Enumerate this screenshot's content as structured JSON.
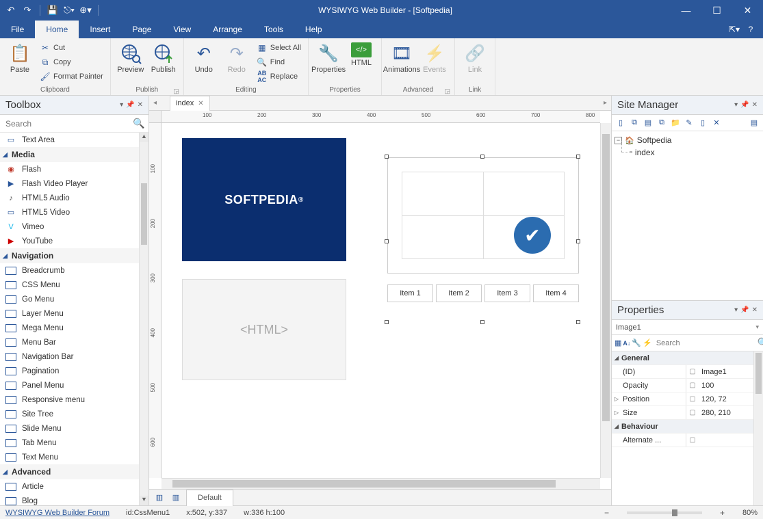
{
  "title": "WYSIWYG Web Builder - [Softpedia]",
  "menu": {
    "tabs": [
      "File",
      "Home",
      "Insert",
      "Page",
      "View",
      "Arrange",
      "Tools",
      "Help"
    ],
    "active": 1
  },
  "ribbon": {
    "clipboard": {
      "label": "Clipboard",
      "paste": "Paste",
      "cut": "Cut",
      "copy": "Copy",
      "fmt": "Format Painter"
    },
    "publish": {
      "label": "Publish",
      "preview": "Preview",
      "publish": "Publish"
    },
    "editing": {
      "label": "Editing",
      "undo": "Undo",
      "redo": "Redo",
      "selectall": "Select All",
      "find": "Find",
      "replace": "Replace"
    },
    "properties": {
      "label": "Properties",
      "properties": "Properties",
      "html": "HTML"
    },
    "advanced": {
      "label": "Advanced",
      "animations": "Animations",
      "events": "Events"
    },
    "link": {
      "label": "Link",
      "link": "Link"
    }
  },
  "toolbox": {
    "title": "Toolbox",
    "search_placeholder": "Search",
    "items_pre": [
      {
        "label": "Text Area"
      }
    ],
    "cat_media": "Media",
    "media": [
      {
        "label": "Flash",
        "color": "#c0392b"
      },
      {
        "label": "Flash Video Player",
        "color": "#2b579a"
      },
      {
        "label": "HTML5 Audio",
        "color": "#444"
      },
      {
        "label": "HTML5 Video",
        "color": "#2b579a"
      },
      {
        "label": "Vimeo",
        "color": "#1ab7ea"
      },
      {
        "label": "YouTube",
        "color": "#cc0000"
      }
    ],
    "cat_nav": "Navigation",
    "nav": [
      {
        "label": "Breadcrumb"
      },
      {
        "label": "CSS Menu"
      },
      {
        "label": "Go Menu"
      },
      {
        "label": "Layer Menu"
      },
      {
        "label": "Mega Menu"
      },
      {
        "label": "Menu Bar"
      },
      {
        "label": "Navigation Bar"
      },
      {
        "label": "Pagination"
      },
      {
        "label": "Panel Menu"
      },
      {
        "label": "Responsive menu"
      },
      {
        "label": "Site Tree"
      },
      {
        "label": "Slide Menu"
      },
      {
        "label": "Tab Menu"
      },
      {
        "label": "Text Menu"
      }
    ],
    "cat_adv": "Advanced",
    "adv": [
      {
        "label": "Article"
      },
      {
        "label": "Blog"
      }
    ]
  },
  "doc": {
    "tab": "index"
  },
  "ruler_h": [
    "100",
    "200",
    "300",
    "400",
    "500",
    "600",
    "700",
    "800"
  ],
  "ruler_v": [
    "100",
    "200",
    "300",
    "400",
    "500",
    "600"
  ],
  "canvas": {
    "softpedia": "SOFTPEDIA",
    "htmlbox": "<HTML>",
    "menu_items": [
      "Item 1",
      "Item 2",
      "Item 3",
      "Item 4"
    ]
  },
  "layerbar": {
    "default": "Default"
  },
  "sitemanager": {
    "title": "Site Manager",
    "root": "Softpedia",
    "page": "index"
  },
  "properties": {
    "title": "Properties",
    "selected": "Image1",
    "search_placeholder": "Search",
    "cat_general": "General",
    "rows": [
      {
        "name": "(ID)",
        "val": "Image1"
      },
      {
        "name": "Opacity",
        "val": "100"
      },
      {
        "name": "Position",
        "val": "120, 72",
        "exp": true
      },
      {
        "name": "Size",
        "val": "280, 210",
        "exp": true
      }
    ],
    "cat_behaviour": "Behaviour",
    "rows2": [
      {
        "name": "Alternate ...",
        "val": ""
      }
    ]
  },
  "status": {
    "forum": "WYSIWYG Web Builder Forum",
    "id": "id:CssMenu1",
    "xy": "x:502, y:337",
    "wh": "w:336 h:100",
    "zoom": "80%"
  }
}
